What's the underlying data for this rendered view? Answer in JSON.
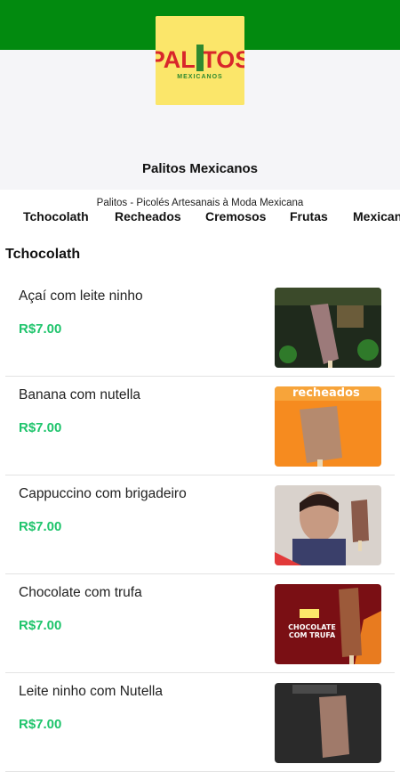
{
  "store": {
    "name": "Palitos Mexicanos",
    "description": "Palitos - Picolés Artesanais à Moda Mexicana",
    "logo_text": "PALITOS",
    "logo_sub": "MEXICANOS"
  },
  "tabs": [
    {
      "label": "Tchocolath"
    },
    {
      "label": "Recheados"
    },
    {
      "label": "Cremosos"
    },
    {
      "label": "Frutas"
    },
    {
      "label": "Mexicanos"
    }
  ],
  "section": {
    "title": "Tchocolath"
  },
  "products": [
    {
      "name": "Açaí com leite ninho",
      "price": "R$7.00",
      "thumb_text": ""
    },
    {
      "name": "Banana com nutella",
      "price": "R$7.00",
      "thumb_text": "recheados"
    },
    {
      "name": "Cappuccino com brigadeiro",
      "price": "R$7.00",
      "thumb_text": ""
    },
    {
      "name": "Chocolate com trufa",
      "price": "R$7.00",
      "thumb_text": "CHOCOLATE COM TRUFA"
    },
    {
      "name": "Leite ninho com Nutella",
      "price": "R$7.00",
      "thumb_text": ""
    }
  ],
  "colors": {
    "topbar": "#028a0f",
    "price": "#1fc46c",
    "hero_bg": "#f5f5f8"
  }
}
